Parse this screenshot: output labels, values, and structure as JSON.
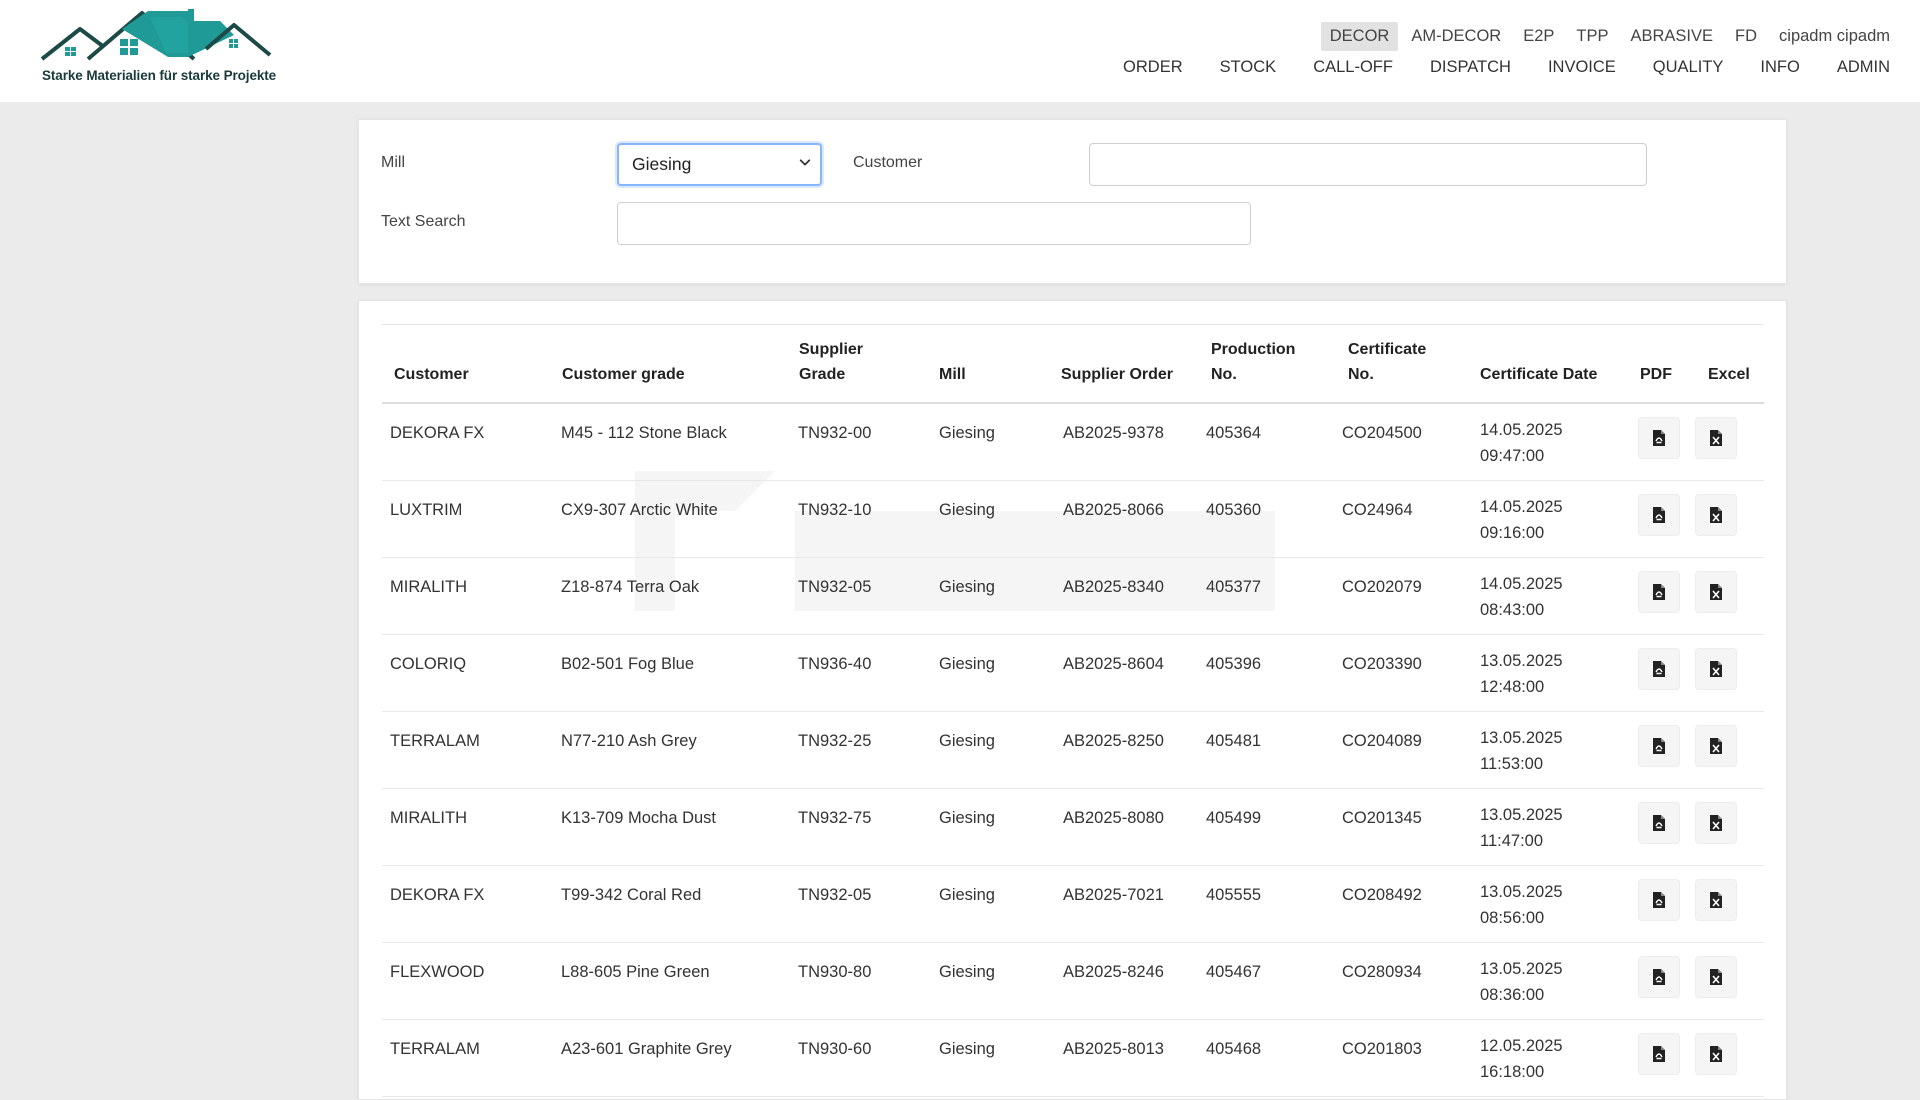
{
  "logo": {
    "tagline": "Starke Materialien für starke Projekte"
  },
  "top_tabs": [
    "DECOR",
    "AM-DECOR",
    "E2P",
    "TPP",
    "ABRASIVE",
    "FD"
  ],
  "active_tab": "DECOR",
  "user": "cipadm cipadm",
  "main_nav": [
    "ORDER",
    "STOCK",
    "CALL-OFF",
    "DISPATCH",
    "INVOICE",
    "QUALITY",
    "INFO",
    "ADMIN"
  ],
  "filters": {
    "mill_label": "Mill",
    "mill_value": "Giesing",
    "customer_label": "Customer",
    "customer_value": "",
    "text_search_label": "Text Search",
    "text_search_value": ""
  },
  "table": {
    "headers": {
      "customer": "Customer",
      "customer_grade": "Customer grade",
      "supplier_grade_1": "Supplier",
      "supplier_grade_2": "Grade",
      "mill": "Mill",
      "supplier_order": "Supplier Order",
      "production_1": "Production",
      "production_2": "No.",
      "certificate_1": "Certificate",
      "certificate_2": "No.",
      "certificate_date": "Certificate Date",
      "pdf": "PDF",
      "excel": "Excel"
    },
    "rows": [
      {
        "customer": "DEKORA FX",
        "grade": "M45 - 112 Stone Black",
        "supplier_grade": "TN932-00",
        "mill": "Giesing",
        "order": "AB2025-9378",
        "production": "405364",
        "certificate": "CO204500",
        "date": "14.05.2025",
        "time": "09:47:00"
      },
      {
        "customer": "LUXTRIM",
        "grade": "CX9-307 Arctic White",
        "supplier_grade": "TN932-10",
        "mill": "Giesing",
        "order": "AB2025-8066",
        "production": "405360",
        "certificate": "CO24964",
        "date": "14.05.2025",
        "time": "09:16:00"
      },
      {
        "customer": "MIRALITH",
        "grade": "Z18-874 Terra Oak",
        "supplier_grade": "TN932-05",
        "mill": "Giesing",
        "order": "AB2025-8340",
        "production": "405377",
        "certificate": "CO202079",
        "date": "14.05.2025",
        "time": "08:43:00"
      },
      {
        "customer": "COLORIQ",
        "grade": "B02-501 Fog Blue",
        "supplier_grade": "TN936-40",
        "mill": "Giesing",
        "order": "AB2025-8604",
        "production": "405396",
        "certificate": "CO203390",
        "date": "13.05.2025",
        "time": "12:48:00"
      },
      {
        "customer": "TERRALAM",
        "grade": "N77-210 Ash Grey",
        "supplier_grade": "TN932-25",
        "mill": "Giesing",
        "order": "AB2025-8250",
        "production": "405481",
        "certificate": "CO204089",
        "date": "13.05.2025",
        "time": "11:53:00"
      },
      {
        "customer": "MIRALITH",
        "grade": "K13-709 Mocha Dust",
        "supplier_grade": "TN932-75",
        "mill": "Giesing",
        "order": "AB2025-8080",
        "production": "405499",
        "certificate": "CO201345",
        "date": "13.05.2025",
        "time": "11:47:00"
      },
      {
        "customer": "DEKORA FX",
        "grade": "T99-342 Coral Red",
        "supplier_grade": "TN932-05",
        "mill": "Giesing",
        "order": "AB2025-7021",
        "production": "405555",
        "certificate": "CO208492",
        "date": "13.05.2025",
        "time": "08:56:00"
      },
      {
        "customer": "FLEXWOOD",
        "grade": "L88-605 Pine Green",
        "supplier_grade": "TN930-80",
        "mill": "Giesing",
        "order": "AB2025-8246",
        "production": "405467",
        "certificate": "CO280934",
        "date": "13.05.2025",
        "time": "08:36:00"
      },
      {
        "customer": "TERRALAM",
        "grade": "A23-601 Graphite Grey",
        "supplier_grade": "TN930-60",
        "mill": "Giesing",
        "order": "AB2025-8013",
        "production": "405468",
        "certificate": "CO201803",
        "date": "12.05.2025",
        "time": "16:18:00"
      }
    ]
  },
  "icons": {
    "pdf": "pdf-file-icon",
    "excel": "excel-file-icon",
    "mill_select": "chevron-down-icon"
  },
  "colors": {
    "brand": "#1f9a96",
    "active_tab_bg": "#e2e2e2",
    "focus_border": "#86b7fe"
  }
}
